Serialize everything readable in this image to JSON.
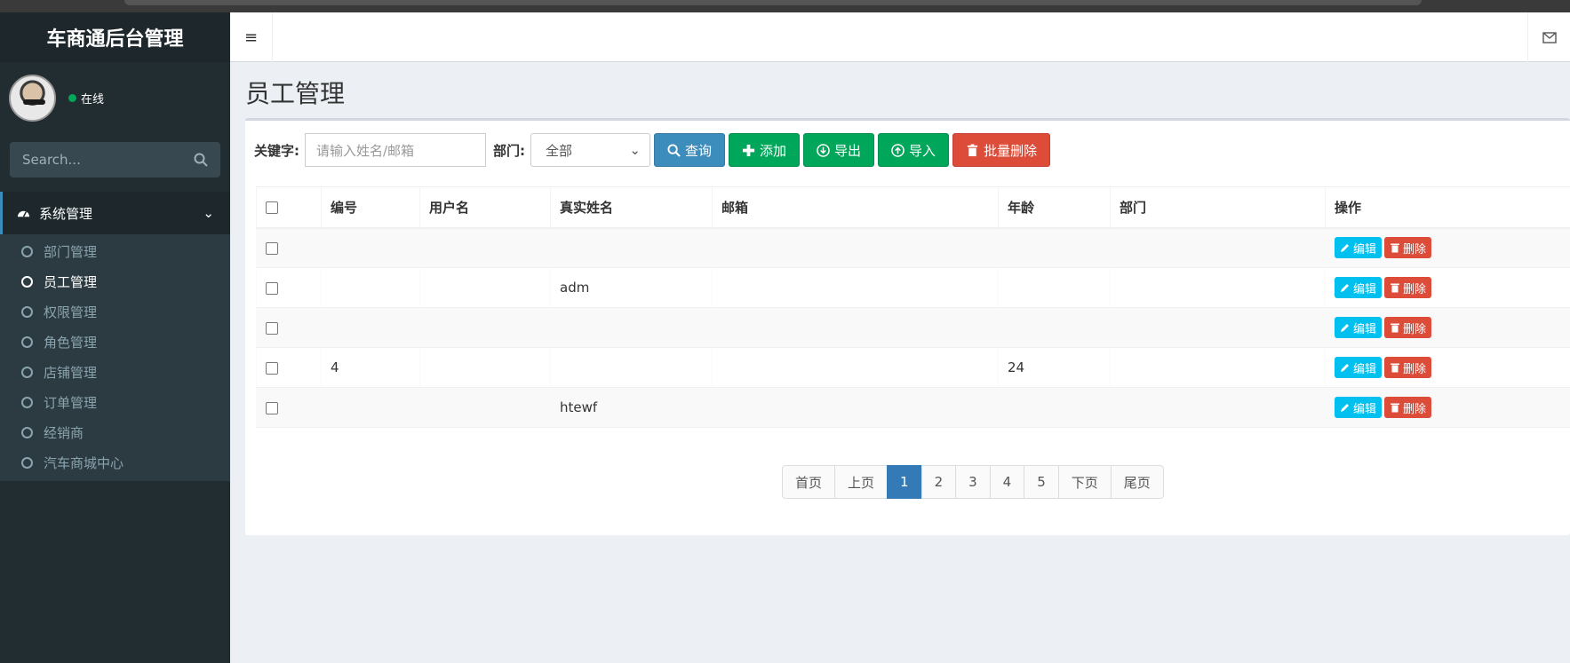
{
  "sidebar": {
    "brand": "车商通后台管理",
    "status": "在线",
    "search_placeholder": "Search...",
    "menu_title": "系统管理",
    "items": [
      "部门管理",
      "员工管理",
      "权限管理",
      "角色管理",
      "店铺管理",
      "订单管理",
      "经销商",
      "汽车商城中心"
    ],
    "active_item": "员工管理"
  },
  "page": {
    "title": "员工管理"
  },
  "filters": {
    "keyword_label": "关键字:",
    "keyword_placeholder": "请输入姓名/邮箱",
    "dept_label": "部门:",
    "dept_value": "全部",
    "buttons": {
      "query": "查询",
      "add": "添加",
      "export": "导出",
      "import": "导入",
      "batch_delete": "批量删除"
    }
  },
  "table": {
    "headers": [
      "编号",
      "用户名",
      "真实姓名",
      "邮箱",
      "年龄",
      "部门",
      "操作"
    ],
    "rows": [
      {
        "id": "",
        "username": "",
        "realname": "",
        "email": "",
        "age": "",
        "dept": ""
      },
      {
        "id": "",
        "username": "",
        "realname": "adm",
        "email": "",
        "age": "",
        "dept": ""
      },
      {
        "id": "",
        "username": "",
        "realname": "",
        "email": "",
        "age": "",
        "dept": ""
      },
      {
        "id": "4",
        "username": "",
        "realname": "",
        "email": "",
        "age": "24",
        "dept": ""
      },
      {
        "id": "",
        "username": "",
        "realname": "htewf",
        "email": "",
        "age": "",
        "dept": ""
      }
    ],
    "edit_label": "编辑",
    "delete_label": "删除"
  },
  "pagination": {
    "first": "首页",
    "prev": "上页",
    "pages": [
      "1",
      "2",
      "3",
      "4",
      "5"
    ],
    "current": "1",
    "next": "下页",
    "last": "尾页"
  },
  "colors": {
    "sidebar_bg": "#222d32",
    "primary": "#3c8dbc",
    "success": "#00a65a",
    "danger": "#dd4b39",
    "info": "#00c0ef"
  }
}
